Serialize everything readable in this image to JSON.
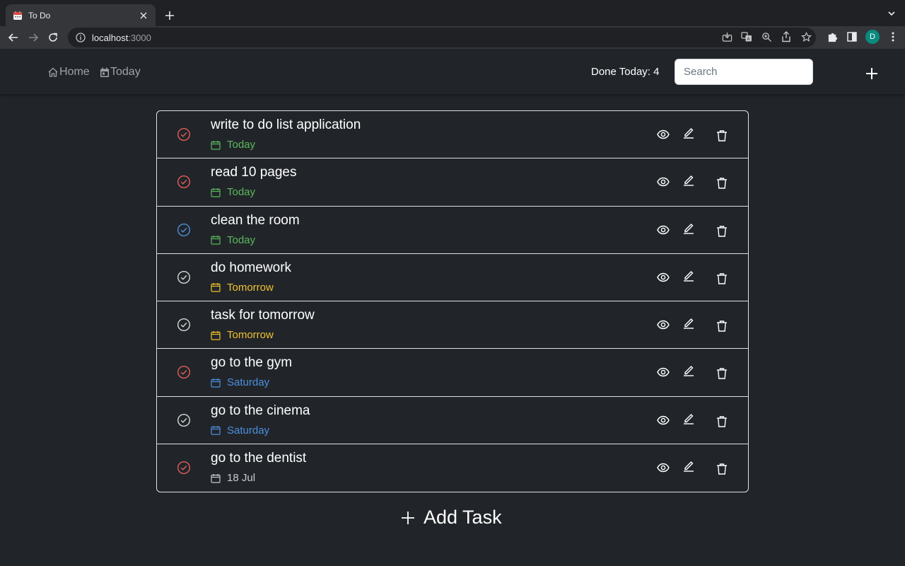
{
  "browser": {
    "tab_title": "To Do",
    "url_host": "localhost",
    "url_port": ":3000",
    "profile_initial": "D"
  },
  "nav": {
    "home_label": "Home",
    "today_label": "Today",
    "done_today": "Done Today: 4",
    "search_placeholder": "Search"
  },
  "tasks": [
    {
      "title": "write to do list application",
      "due": "Today",
      "due_color": "#5cb85c",
      "check_color": "#e35d5b"
    },
    {
      "title": "read 10 pages",
      "due": "Today",
      "due_color": "#5cb85c",
      "check_color": "#e35d5b"
    },
    {
      "title": "clean the room",
      "due": "Today",
      "due_color": "#5cb85c",
      "check_color": "#4d8fe0"
    },
    {
      "title": "do homework",
      "due": "Tomorrow",
      "due_color": "#f0c030",
      "check_color": "#d8d8d8"
    },
    {
      "title": "task for tomorrow",
      "due": "Tomorrow",
      "due_color": "#f0c030",
      "check_color": "#d8d8d8"
    },
    {
      "title": "go to the gym",
      "due": "Saturday",
      "due_color": "#4d8fe0",
      "check_color": "#e35d5b"
    },
    {
      "title": "go to the cinema",
      "due": "Saturday",
      "due_color": "#4d8fe0",
      "check_color": "#d8d8d8"
    },
    {
      "title": "go to the dentist",
      "due": "18 Jul",
      "due_color": "#c8cbce",
      "check_color": "#e35d5b"
    }
  ],
  "footer": {
    "add_task_label": "Add Task"
  }
}
